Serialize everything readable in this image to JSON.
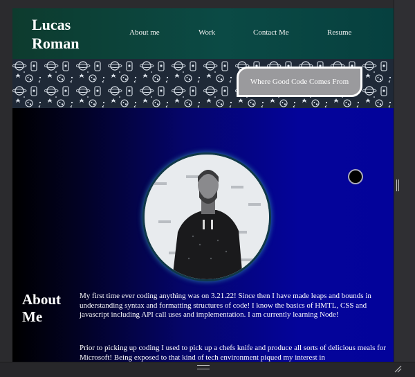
{
  "header": {
    "brand_line1": "Lucas",
    "brand_line2": "Roman",
    "nav": [
      "About me",
      "Work",
      "Contact Me",
      "Resume"
    ]
  },
  "banner": {
    "tagline": "Where Good Code Comes From"
  },
  "about": {
    "heading_line1": "About",
    "heading_line2": "Me",
    "paragraph1": "My first time ever coding anything was on 3.21.22! Since then I have made leaps and bounds in understanding syntax and formatting structures of code! I know the basics of HMTL, CSS and javascript including API call uses and implementation. I am currently learning Node!",
    "paragraph2": "Prior to picking up coding I used to pick up a chefs knife and produce all sorts of delicious meals for Microsoft! Being exposed to that kind of tech environment piqued my interest in"
  },
  "colors": {
    "header_bg": "#0b4a45",
    "main_gradient_end": "#03039a",
    "tagline_bg": "#9a9a9d"
  },
  "icons": {
    "portrait": "profile-photo",
    "scroll": "scroll-grip-icon",
    "resize": "resize-handle-icon"
  }
}
